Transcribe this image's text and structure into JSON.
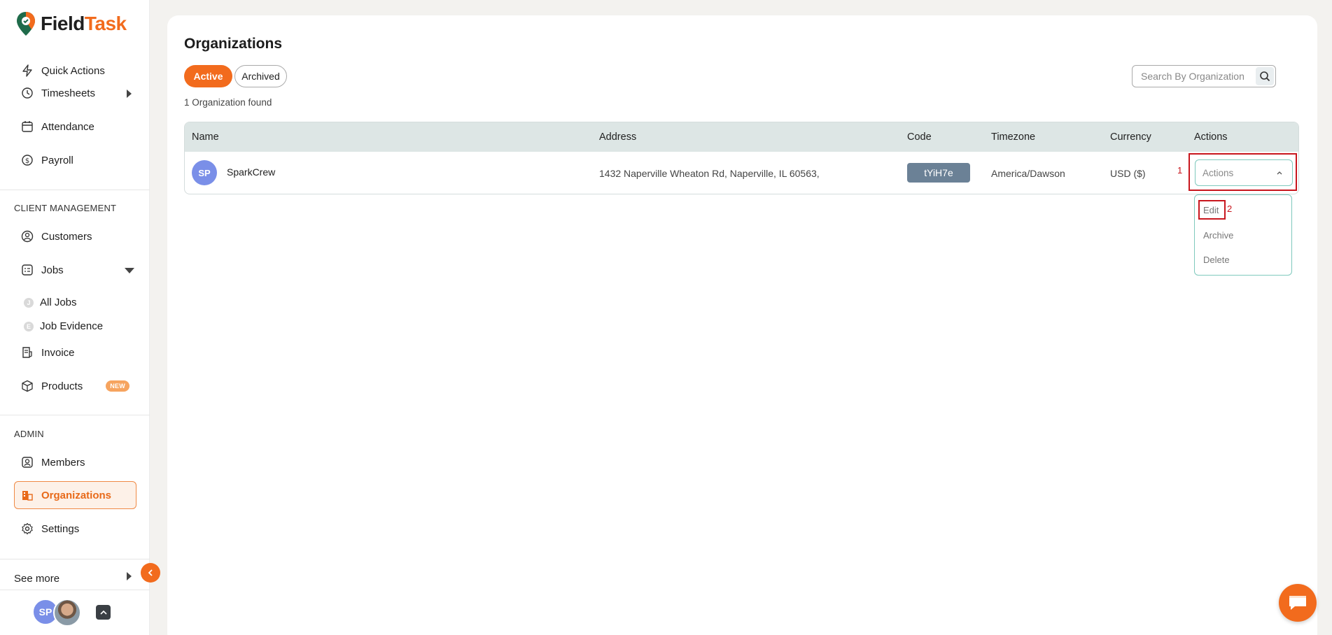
{
  "brand": {
    "name_part1": "Field",
    "name_part2": "Task",
    "accent": "#f26b1d"
  },
  "sidebar": {
    "items": [
      {
        "label": "Quick Actions",
        "icon": "lightning-icon"
      },
      {
        "label": "Timesheets",
        "icon": "clock-icon"
      },
      {
        "label": "Attendance",
        "icon": "calendar-icon"
      },
      {
        "label": "Payroll",
        "icon": "dollar-icon"
      }
    ],
    "client_section": "CLIENT MANAGEMENT",
    "client_items": [
      {
        "label": "Customers",
        "icon": "user-circle-icon"
      },
      {
        "label": "Jobs",
        "icon": "jobs-icon"
      },
      {
        "label": "All Jobs",
        "icon_letter": "J"
      },
      {
        "label": "Job Evidence",
        "icon_letter": "E"
      },
      {
        "label": "Invoice",
        "icon": "invoice-icon"
      },
      {
        "label": "Products",
        "icon": "box-icon",
        "badge": "NEW"
      }
    ],
    "admin_section": "ADMIN",
    "admin_items": [
      {
        "label": "Members",
        "icon": "member-icon"
      },
      {
        "label": "Organizations",
        "icon": "organization-icon",
        "active": true
      },
      {
        "label": "Settings",
        "icon": "gear-icon"
      }
    ],
    "see_more": "See more",
    "user_initials": "SP"
  },
  "main": {
    "title": "Organizations",
    "tabs": [
      {
        "label": "Active",
        "active": true
      },
      {
        "label": "Archived",
        "active": false
      }
    ],
    "count_text": "1 Organization found",
    "search_placeholder": "Search By Organization",
    "table": {
      "columns": [
        "Name",
        "Address",
        "Code",
        "Timezone",
        "Currency",
        "Actions"
      ],
      "rows": [
        {
          "initials": "SP",
          "name": "SparkCrew",
          "address": "1432 Naperville Wheaton Rd, Naperville, IL 60563,",
          "code": "tYiH7e",
          "timezone": "America/Dawson",
          "currency": "USD ($)",
          "actions_placeholder": "Actions"
        }
      ]
    },
    "actions_menu": [
      "Edit",
      "Archive",
      "Delete"
    ],
    "annotations": [
      "1",
      "2"
    ]
  }
}
